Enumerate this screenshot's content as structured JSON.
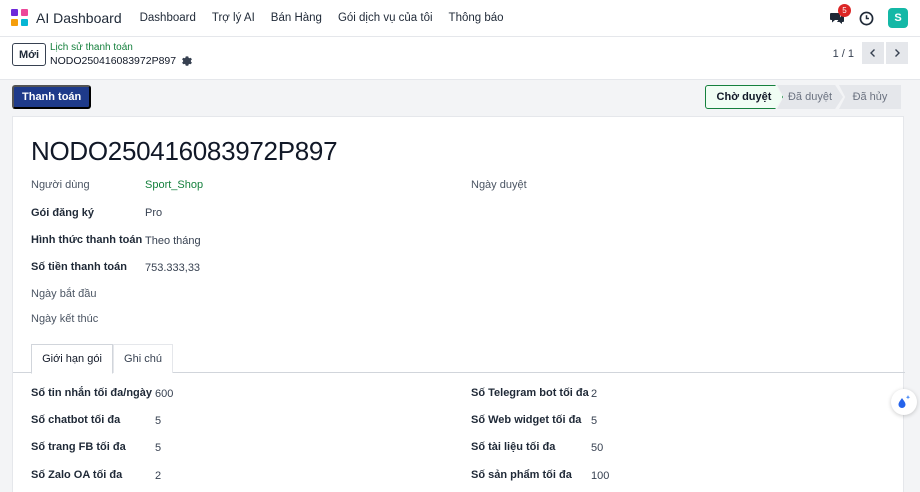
{
  "navbar": {
    "app_title": "AI Dashboard",
    "menu": [
      "Dashboard",
      "Trợ lý AI",
      "Bán Hàng",
      "Gói dịch vụ của tôi",
      "Thông báo"
    ],
    "message_count": "5",
    "avatar_letter": "S"
  },
  "control": {
    "new_label": "Mới",
    "breadcrumb_parent": "Lịch sử thanh toán",
    "breadcrumb_current": "NODO250416083972P897",
    "pager": "1 / 1"
  },
  "statusbar": {
    "pay_label": "Thanh toán",
    "stages": [
      "Chờ duyệt",
      "Đã duyệt",
      "Đã hủy"
    ],
    "active_stage": "Chờ duyệt"
  },
  "record": {
    "title": "NODO250416083972P897",
    "fields_left": [
      {
        "label": "Người dùng",
        "value": "Sport_Shop"
      },
      {
        "label": "Gói đăng ký",
        "value": "Pro"
      },
      {
        "label": "Hình thức thanh toán",
        "value": "Theo tháng"
      },
      {
        "label": "Số tiền thanh toán",
        "value": "753.333,33"
      },
      {
        "label": "Ngày bắt đầu",
        "value": ""
      },
      {
        "label": "Ngày kết thúc",
        "value": ""
      }
    ],
    "approval_date_label": "Ngày duyệt"
  },
  "tabs": [
    "Giới hạn gói",
    "Ghi chú"
  ],
  "limits_left": [
    {
      "label": "Số tin nhắn tối đa/ngày",
      "value": "600"
    },
    {
      "label": "Số chatbot tối đa",
      "value": "5"
    },
    {
      "label": "Số trang FB tối đa",
      "value": "5"
    },
    {
      "label": "Số Zalo OA tối đa",
      "value": "2"
    }
  ],
  "limits_right": [
    {
      "label": "Số Telegram bot tối đa",
      "value": "2"
    },
    {
      "label": "Số Web widget tối đa",
      "value": "5"
    },
    {
      "label": "Số tài liệu tối đa",
      "value": "50"
    },
    {
      "label": "Số sản phẩm tối đa",
      "value": "100"
    }
  ],
  "colors": {
    "primary": "#1e3a8a",
    "link_green": "#15803d",
    "badge_red": "#dc2626",
    "avatar_teal": "#14b8a6"
  }
}
